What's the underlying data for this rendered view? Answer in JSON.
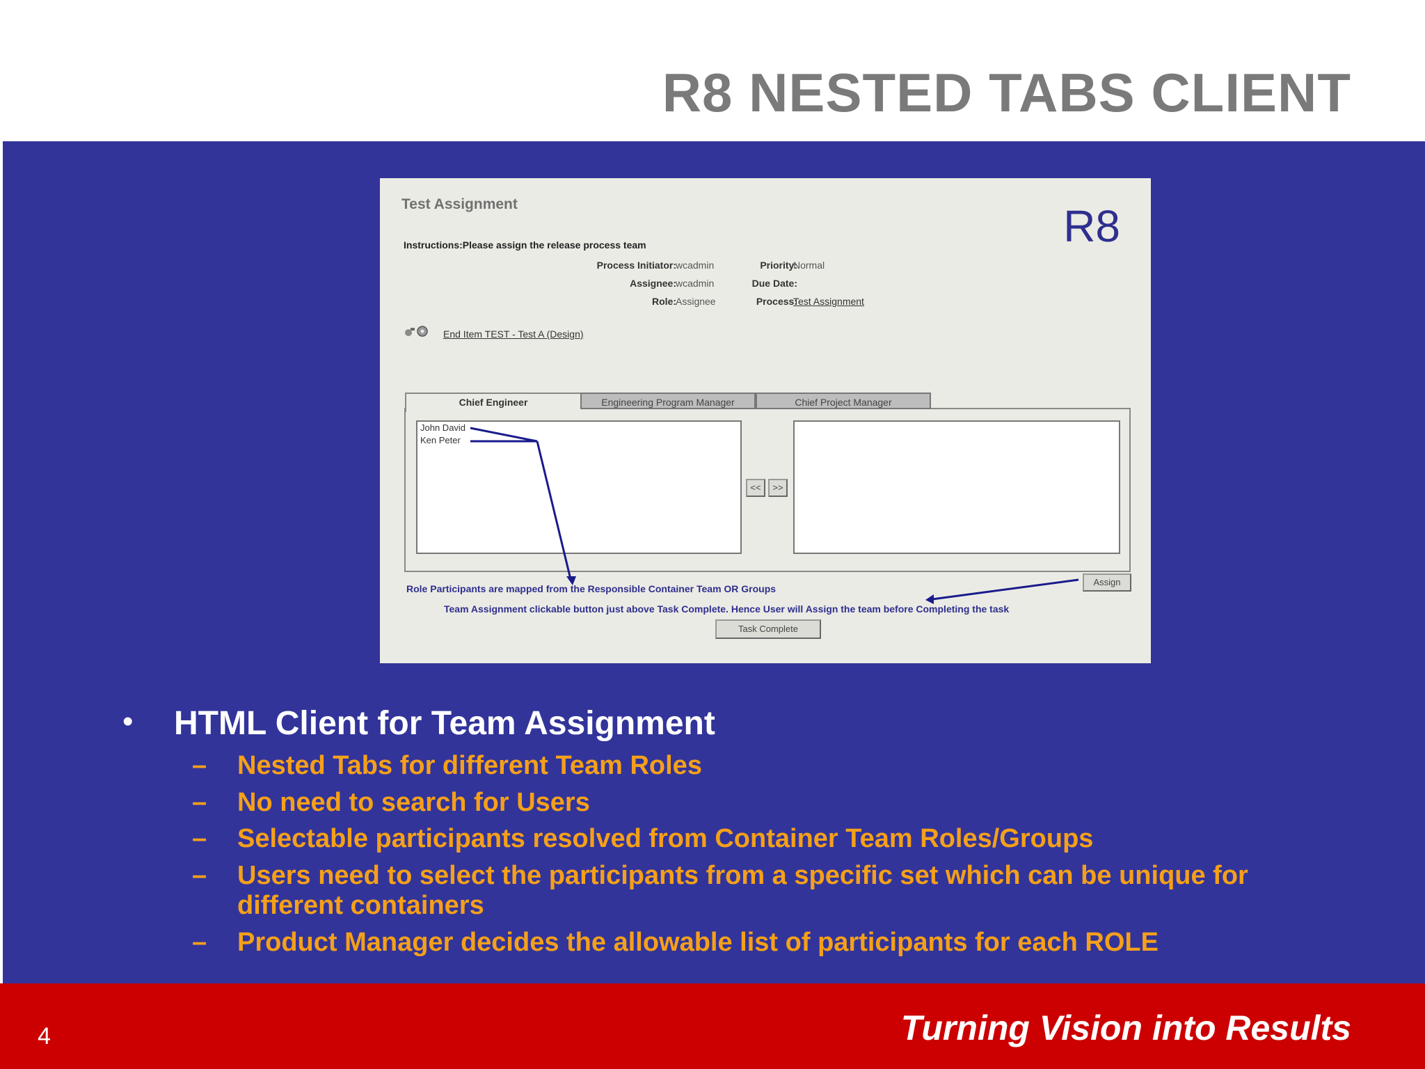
{
  "slide": {
    "title": "R8 NESTED TABS CLIENT",
    "number": "4",
    "tagline": "Turning  Vision into Results"
  },
  "screenshot": {
    "window_title": "Test Assignment",
    "badge": "R8",
    "instructions": "Instructions:Please assign the release process team",
    "fields": {
      "process_initiator_label": "Process Initiator:",
      "process_initiator_value": "wcadmin",
      "priority_label": "Priority:",
      "priority_value": "Normal",
      "assignee_label": "Assignee:",
      "assignee_value": "wcadmin",
      "due_date_label": "Due Date:",
      "role_label": "Role:",
      "role_value": "Assignee",
      "process_label": "Process:",
      "process_value": "Test Assignment"
    },
    "end_item_link": "End Item TEST - Test A (Design)",
    "tabs": [
      {
        "label": "Chief Engineer",
        "active": true
      },
      {
        "label": "Engineering Program Manager",
        "active": false
      },
      {
        "label": "Chief Project Manager",
        "active": false
      }
    ],
    "participants": [
      "John David",
      "Ken Peter"
    ],
    "move_left_label": "<<",
    "move_right_label": ">>",
    "assign_label": "Assign",
    "task_complete_label": "Task Complete",
    "note_mapping": "Role Participants are mapped from the Responsible Container Team OR Groups",
    "note_button": "Team Assignment clickable button just above Task Complete. Hence User will Assign the team before Completing the task",
    "annotation_color": "#1a1a8c"
  },
  "bullets": {
    "main": "HTML Client for Team Assignment",
    "sub": [
      "Nested Tabs for different Team Roles",
      "No need to search for Users",
      "Selectable participants resolved from Container Team Roles/Groups",
      "Users need to select the participants from a specific set which can be unique for different containers",
      "Product Manager  decides the allowable list of participants for each ROLE"
    ]
  },
  "colors": {
    "blue_background": "#32349a",
    "footer_red": "#cc0000",
    "bullet_orange": "#f5a01a",
    "title_gray": "#7a7a7a"
  }
}
